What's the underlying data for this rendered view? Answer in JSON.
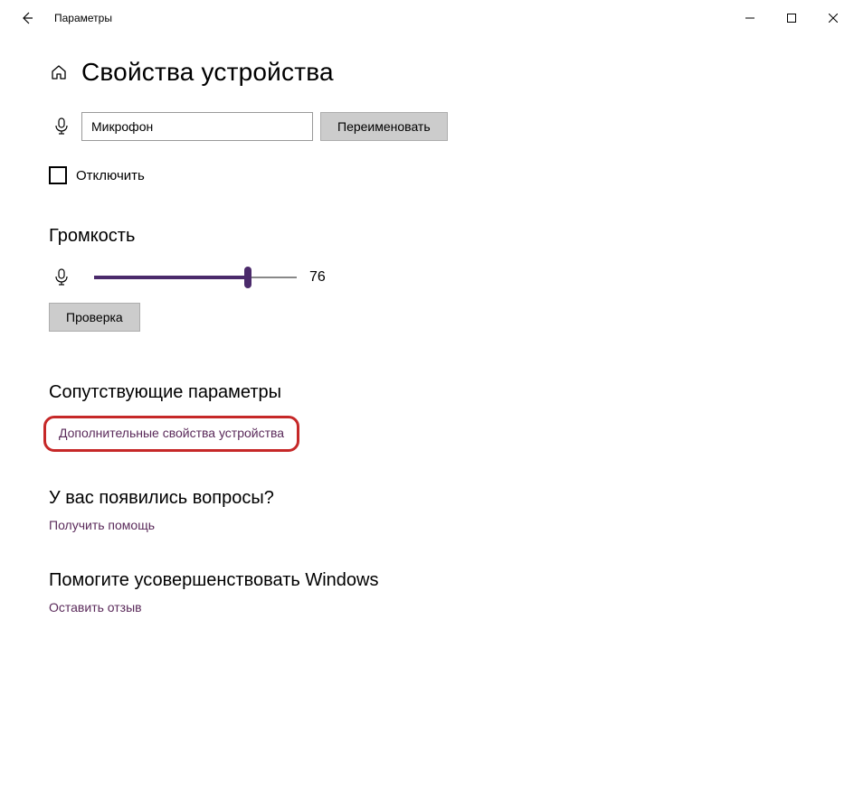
{
  "titlebar": {
    "app_title": "Параметры"
  },
  "header": {
    "page_title": "Свойства устройства"
  },
  "device": {
    "name_value": "Микрофон",
    "rename_label": "Переименовать",
    "disable_label": "Отключить"
  },
  "volume": {
    "section_label": "Громкость",
    "value": "76",
    "percent": 76,
    "test_label": "Проверка"
  },
  "related": {
    "section_label": "Сопутствующие параметры",
    "advanced_link": "Дополнительные свойства устройства"
  },
  "help": {
    "question_label": "У вас появились вопросы?",
    "get_help_link": "Получить помощь"
  },
  "feedback": {
    "section_label": "Помогите усовершенствовать Windows",
    "feedback_link": "Оставить отзыв"
  },
  "colors": {
    "accent": "#4b2a6b",
    "link": "#5a2a5a",
    "highlight": "#c62828"
  }
}
